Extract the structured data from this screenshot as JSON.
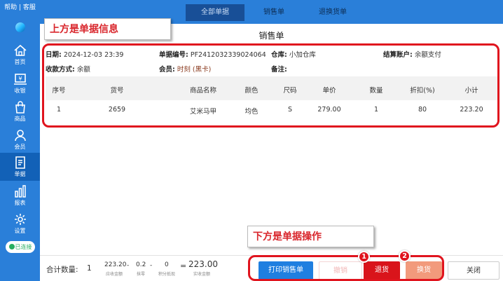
{
  "sidebar": {
    "help": "帮助 | 客服",
    "items": [
      {
        "label": "首页",
        "icon": "home-icon"
      },
      {
        "label": "收银",
        "icon": "cashier-icon"
      },
      {
        "label": "商品",
        "icon": "product-bag-icon"
      },
      {
        "label": "会员",
        "icon": "member-icon"
      },
      {
        "label": "单据",
        "icon": "document-icon"
      },
      {
        "label": "报表",
        "icon": "report-chart-icon"
      },
      {
        "label": "设置",
        "icon": "gear-icon"
      }
    ],
    "active": "单据",
    "connection": "已连接"
  },
  "tabs": [
    "全部单据",
    "销售单",
    "退换货单"
  ],
  "active_tab": "全部单据",
  "document": {
    "title": "销售单",
    "date_label": "日期:",
    "date": "2024-12-03 23:39",
    "number_label": "单据编号:",
    "number": "PF2412032339024064",
    "warehouse_label": "仓库:",
    "warehouse": "小加仓库",
    "account_label": "结算账户:",
    "account": "余额支付",
    "payment_label": "收款方式:",
    "payment": "余额",
    "member_label": "会员:",
    "member": "时刻 (黑卡)",
    "remark_label": "备注:"
  },
  "table": {
    "columns": [
      "序号",
      "货号",
      "商品名称",
      "颜色",
      "尺码",
      "单价",
      "数量",
      "折扣(%)",
      "小计"
    ],
    "rows": [
      [
        "1",
        "2659",
        "艾米马甲",
        "均色",
        "S",
        "279.00",
        "1",
        "80",
        "223.20"
      ]
    ]
  },
  "annotations": {
    "top": "上方是单据信息",
    "bottom": "下方是单据操作",
    "badge1": "1",
    "badge2": "2"
  },
  "summary": {
    "qty_label": "合计数量:",
    "qty": "1",
    "receivable": "223.20",
    "receivable_label": "应收金额",
    "minus1": "-",
    "change": "0.2",
    "change_label": "抹零",
    "minus2": "-",
    "points": "0",
    "points_label": "积分抵现",
    "equals": "=",
    "actual": "223.00",
    "actual_label": "实收金额"
  },
  "buttons": {
    "print": "打印销售单",
    "void": "撤销",
    "return": "退货",
    "exchange": "换货",
    "close": "关闭"
  },
  "colors": {
    "sidebar": "#2a7fd9",
    "primary_button": "#1f7fe0",
    "return_button": "#d9141b",
    "exchange_button": "#f29a7c",
    "void_text": "#f2b8b8",
    "annotation_red": "#e0141e"
  }
}
